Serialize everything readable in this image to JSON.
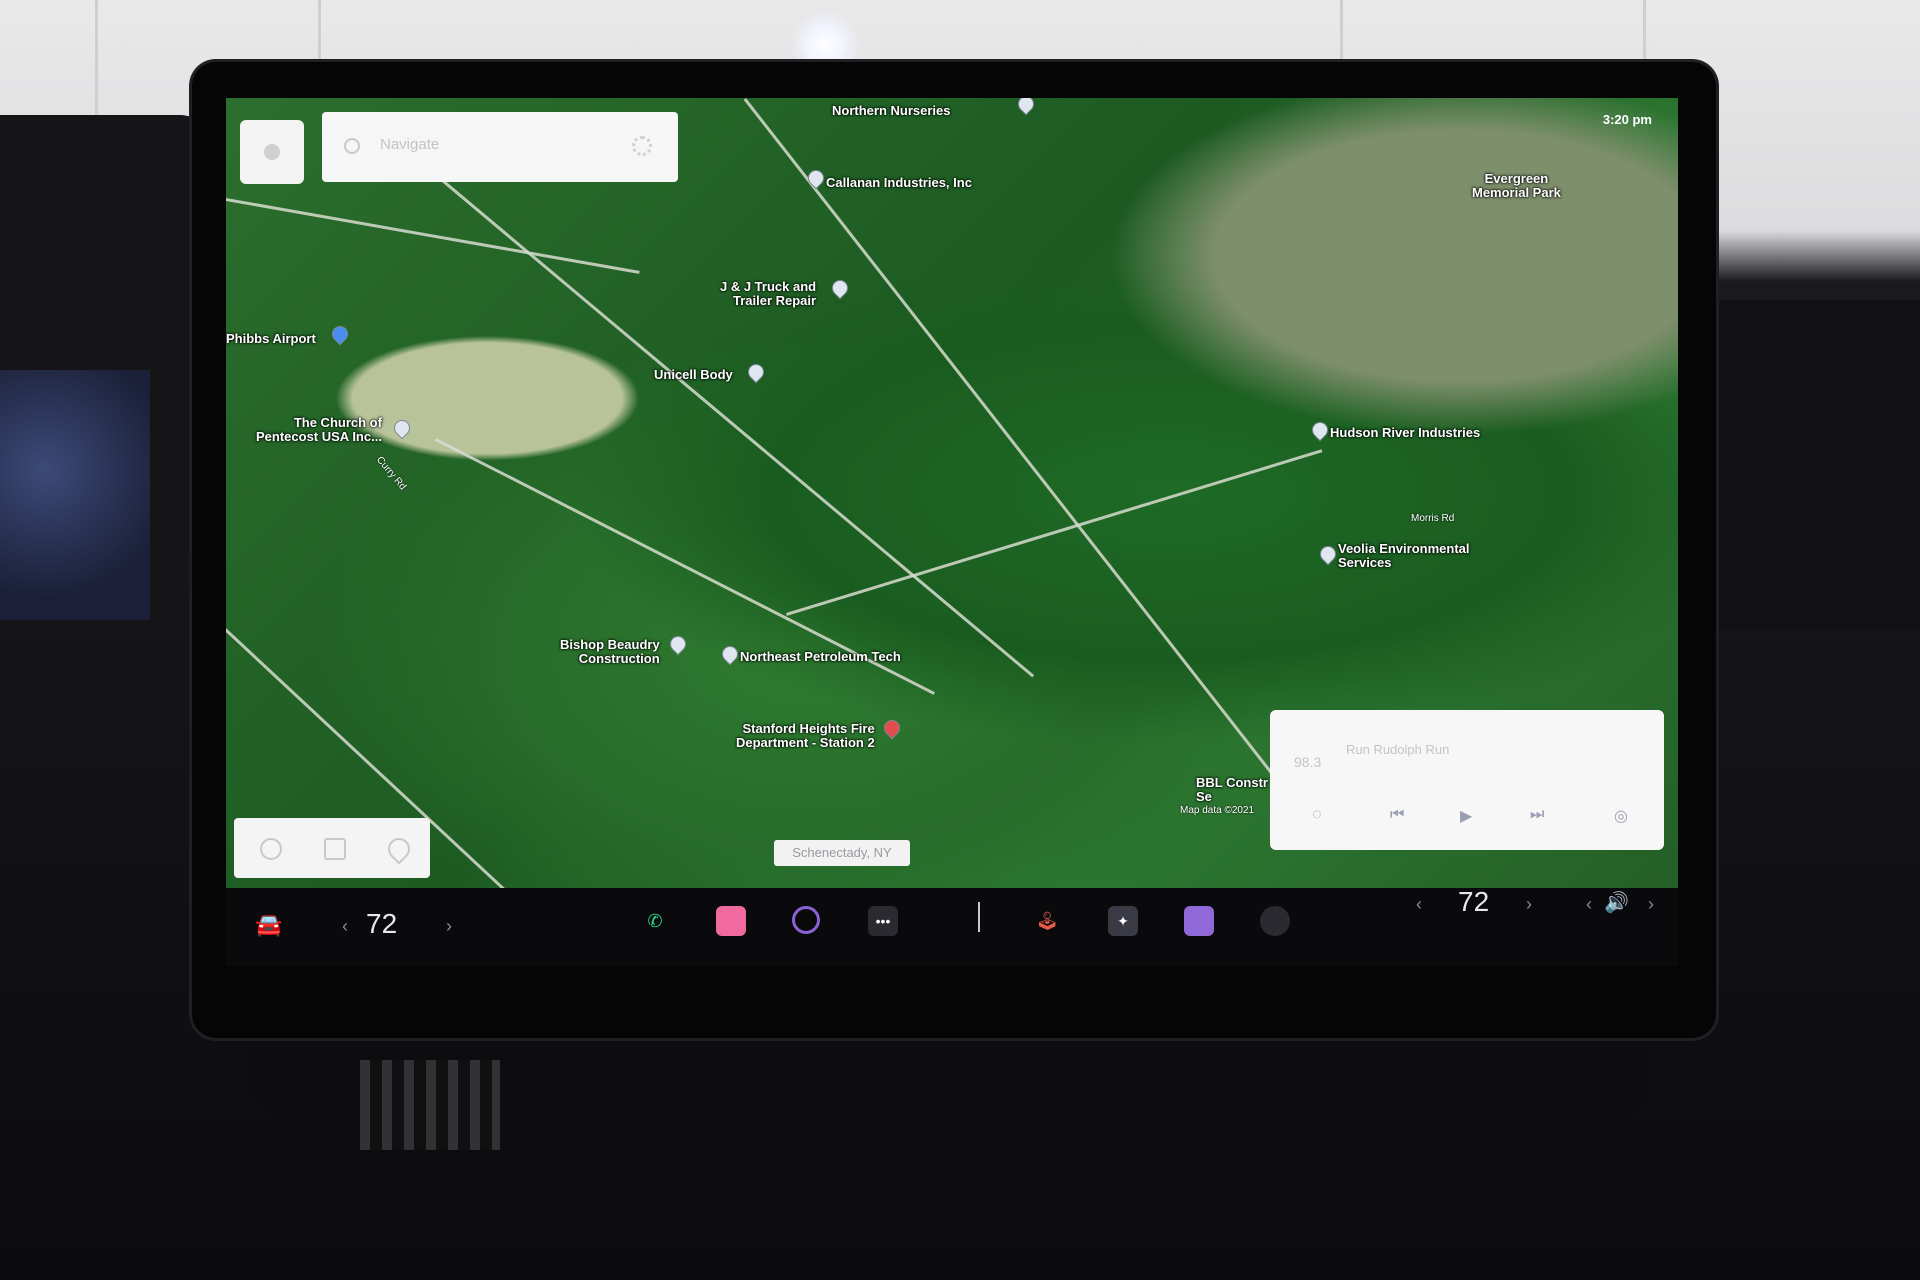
{
  "status": {
    "time": "3:20 pm"
  },
  "search": {
    "placeholder": "Navigate"
  },
  "pois": [
    {
      "label": "Northern Nurseries"
    },
    {
      "label": "Callanan Industries, Inc"
    },
    {
      "label": "J & J Truck and\nTrailer Repair"
    },
    {
      "label": "Unicell Body"
    },
    {
      "label": "Phibbs Airport"
    },
    {
      "label": "The Church of\nPentecost USA Inc..."
    },
    {
      "label": "Evergreen\nMemorial Park"
    },
    {
      "label": "Hudson River Industries"
    },
    {
      "label": "Veolia Environmental\nServices"
    },
    {
      "label": "Bishop Beaudry\nConstruction"
    },
    {
      "label": "Northeast Petroleum Tech"
    },
    {
      "label": "Stanford Heights Fire\nDepartment - Station 2"
    },
    {
      "label": "BBL Constr\nSe"
    }
  ],
  "roads": {
    "morris": "Morris Rd",
    "curry": "Curry Rd"
  },
  "map": {
    "city_label": "Schenectady, NY",
    "attribution": "Map data ©2021"
  },
  "media": {
    "frequency": "98.3",
    "song": "Run Rudolph Run"
  },
  "bottom_bar": {
    "left_temp": "72",
    "right_temp": "72"
  }
}
